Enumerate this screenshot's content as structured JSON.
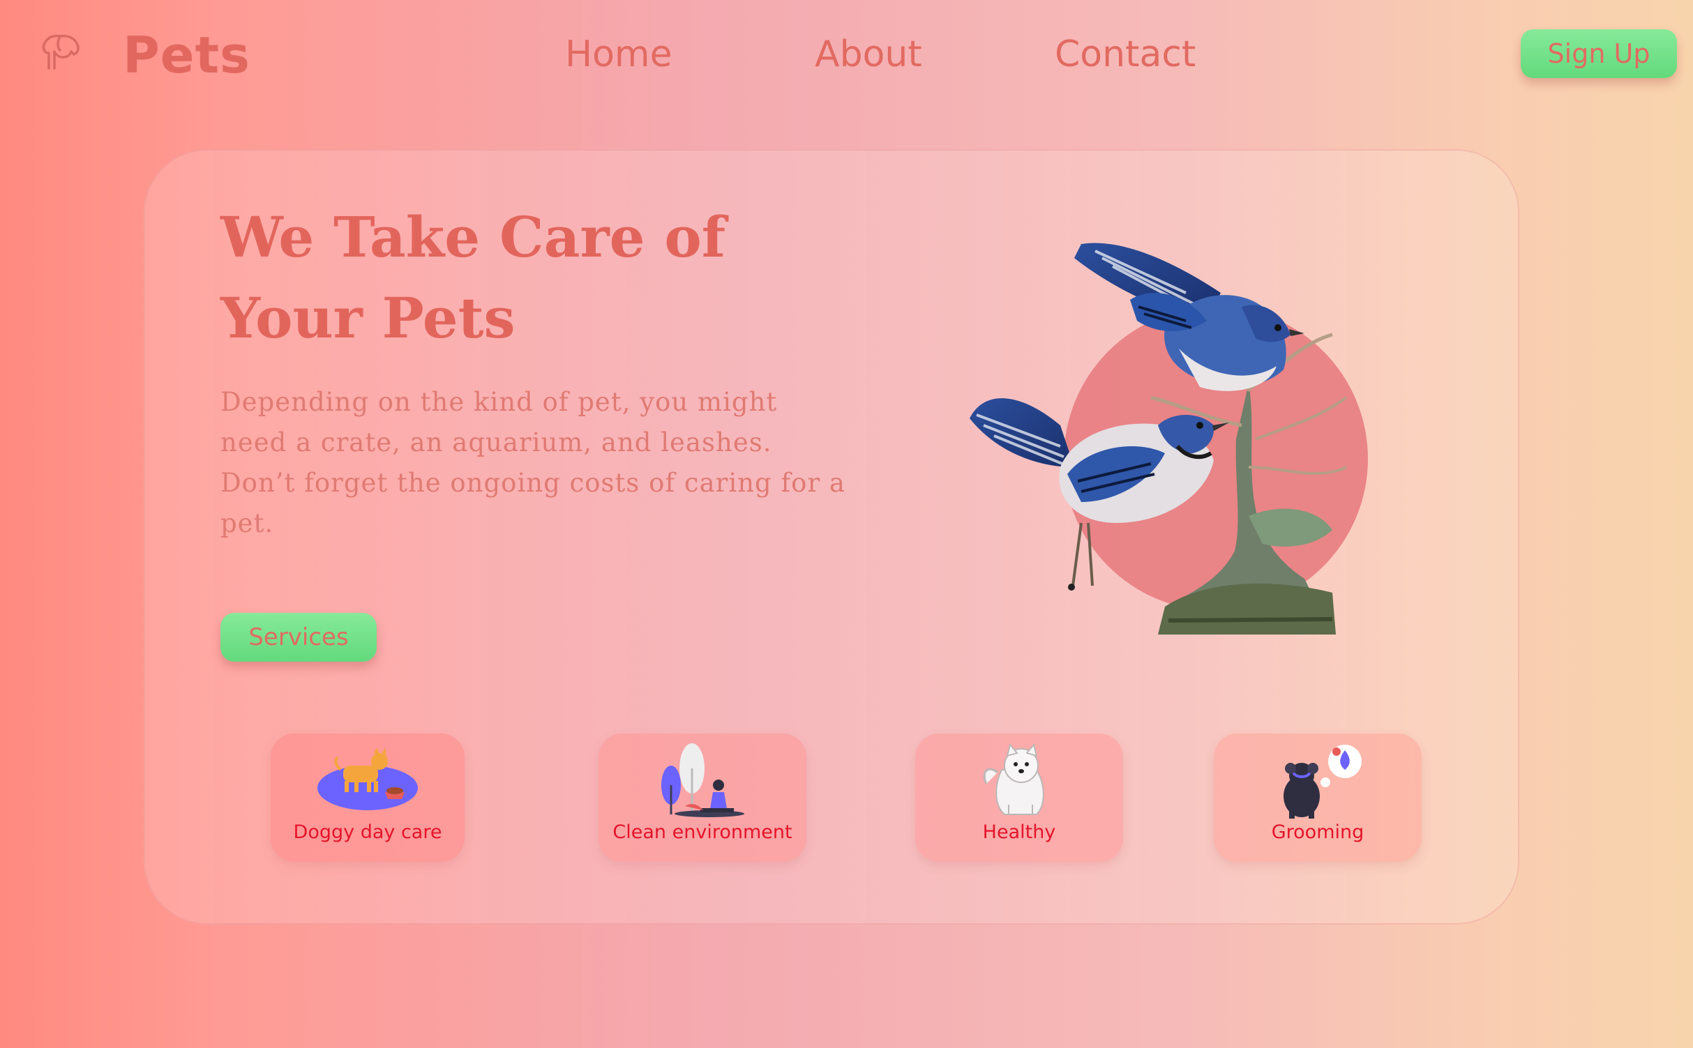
{
  "header": {
    "brand": "Pets",
    "logo_icon": "dog-head-outline-icon",
    "nav": [
      {
        "label": "Home"
      },
      {
        "label": "About"
      },
      {
        "label": "Contact"
      }
    ],
    "signup_label": "Sign Up"
  },
  "hero": {
    "title_line1": "We Take Care of",
    "title_line2": "Your Pets",
    "description": "Depending on the kind of pet, you might need a crate, an aquarium, and leashes. Don’t forget the ongoing costs of caring for a pet.",
    "services_label": "Services",
    "image_icon": "blue-jays-on-branch-illustration"
  },
  "features": [
    {
      "label": "Doggy day care",
      "icon": "dog-with-food-bowl-icon"
    },
    {
      "label": "Clean environment",
      "icon": "person-sitting-with-plants-icon"
    },
    {
      "label": "Healthy",
      "icon": "white-fluffy-dog-icon"
    },
    {
      "label": "Grooming",
      "icon": "dog-with-thought-bubble-icon"
    }
  ],
  "colors": {
    "accent_text": "#e2685f",
    "button_green": "#6ddc83",
    "feature_label": "#e4142a",
    "circle": "#e57d80"
  }
}
